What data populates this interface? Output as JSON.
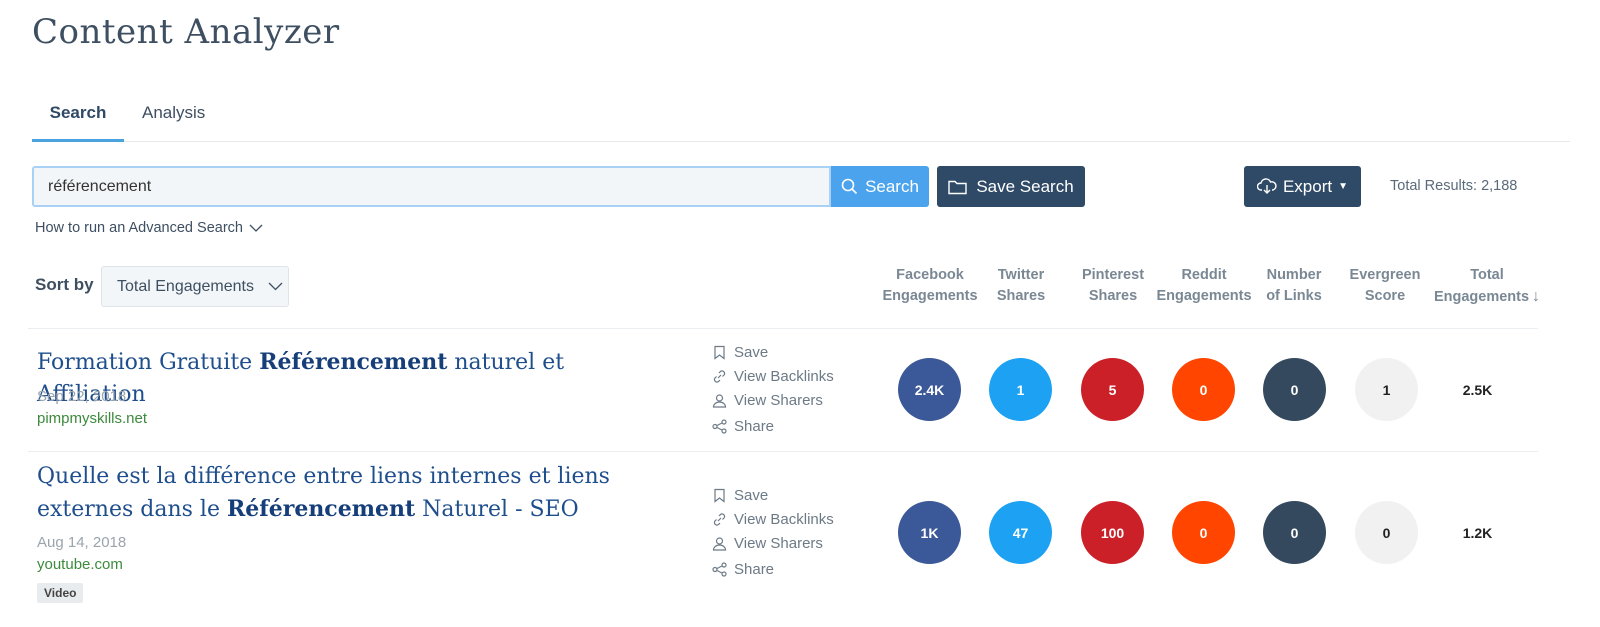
{
  "page": {
    "title": "Content Analyzer"
  },
  "tabs": [
    {
      "label": "Search",
      "active": true
    },
    {
      "label": "Analysis",
      "active": false
    }
  ],
  "search": {
    "value": "référencement",
    "search_button": "Search",
    "save_search_button": "Save Search",
    "export_button": "Export",
    "total_results": "Total Results: 2,188",
    "advanced_link": "How to run an Advanced Search"
  },
  "sort": {
    "label": "Sort by",
    "selected": "Total Engagements"
  },
  "columns": [
    {
      "line1": "Facebook",
      "line2": "Engagements"
    },
    {
      "line1": "Twitter",
      "line2": "Shares"
    },
    {
      "line1": "Pinterest",
      "line2": "Shares"
    },
    {
      "line1": "Reddit",
      "line2": "Engagements"
    },
    {
      "line1": "Number",
      "line2": "of Links"
    },
    {
      "line1": "Evergreen",
      "line2": "Score"
    },
    {
      "line1": "Total",
      "line2": "Engagements"
    }
  ],
  "colors": {
    "facebook": "#3b5998",
    "twitter": "#1da1f2",
    "pinterest": "#cb2027",
    "reddit": "#ff4500",
    "links": "#34495e",
    "evergreen": "#f1f1f1",
    "primary": "#2f4a66",
    "search_button": "#4aa3ec"
  },
  "actions": {
    "save": "Save",
    "backlinks": "View Backlinks",
    "sharers": "View Sharers",
    "share": "Share"
  },
  "results": [
    {
      "title_pre": "Formation Gratuite ",
      "title_bold": "Référencement",
      "title_post": " naturel et Affiliation",
      "date": "Sep 22, 2018",
      "domain": "pimpmyskills.net",
      "badge": "",
      "facebook": "2.4K",
      "twitter": "1",
      "pinterest": "5",
      "reddit": "0",
      "links": "0",
      "evergreen": "1",
      "total": "2.5K"
    },
    {
      "title_pre": "Quelle est la différence entre liens internes et liens externes dans le ",
      "title_bold": "Référencement",
      "title_post": " Naturel - SEO",
      "date": "Aug 14, 2018",
      "domain": "youtube.com",
      "badge": "Video",
      "facebook": "1K",
      "twitter": "47",
      "pinterest": "100",
      "reddit": "0",
      "links": "0",
      "evergreen": "0",
      "total": "1.2K"
    }
  ]
}
